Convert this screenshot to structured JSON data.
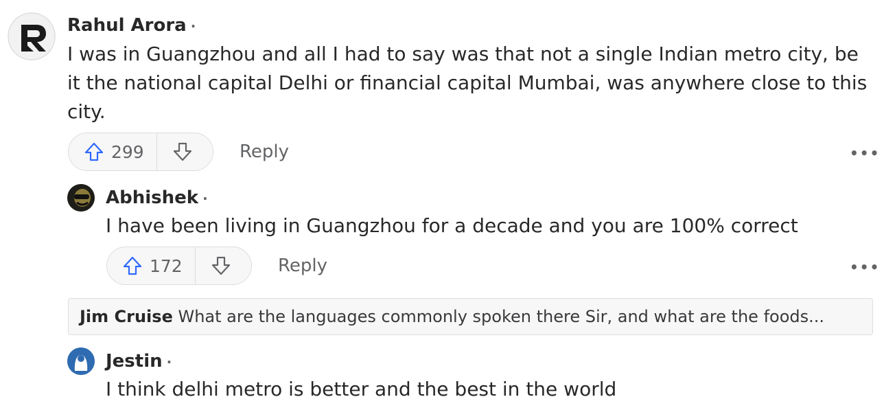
{
  "comments": [
    {
      "author": "Rahul Arora",
      "dot": "·",
      "body": "I was in Guangzhou and all I had to say was that not a single Indian metro city, be it the national capital Delhi or financial capital Mumbai, was anywhere close to this city.",
      "upvotes": "299",
      "reply_label": "Reply",
      "more": "•••"
    },
    {
      "author": "Abhishek",
      "dot": "·",
      "body": "I have been living in Guangzhou for a decade and you are 100% correct",
      "upvotes": "172",
      "reply_label": "Reply",
      "more": "•••"
    }
  ],
  "collapsed_reply": {
    "author": "Jim Cruise",
    "preview": "What are the languages commonly spoken there Sir, and what are the foods..."
  },
  "third_comment": {
    "author": "Jestin",
    "dot": "·",
    "body": "I think delhi metro is better and the best in the world"
  },
  "icons": {
    "avatar1": "logo-r-avatar",
    "avatar2": "photo-avatar",
    "avatar3": "default-user-avatar",
    "upvote": "arrow-up-icon",
    "downvote": "arrow-down-icon",
    "more": "more-options-icon"
  }
}
